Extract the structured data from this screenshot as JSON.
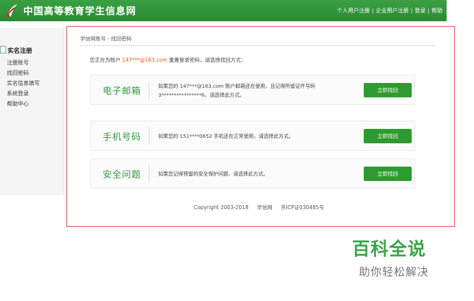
{
  "header": {
    "site_title": "中国高等教育学生信息网",
    "links": [
      "个人用户注册",
      "企业用户注册",
      "登录",
      "帮助"
    ],
    "separator": "|"
  },
  "sidebar": {
    "heading": "实名注册",
    "items": [
      "注册账号",
      "找回密码",
      "实名信息填写",
      "系统登录",
      "帮助中心"
    ]
  },
  "main": {
    "breadcrumb": "学信网账号 - 找回密码",
    "notice_prefix": "您正在为账户",
    "account": "147***@163.com",
    "notice_suffix": "重置登录密码，请选择找回方式：",
    "options": [
      {
        "title": "电子邮箱",
        "desc_line1": "如果您的 147***@163.com 账户邮箱还在使用，且记得所留证件号码",
        "desc_line2": "3****************6，请选择此方式。",
        "button": "立即找回"
      },
      {
        "title": "手机号码",
        "desc_line1": "如果您的 151****0652 手机还在正常使用，请选择此方式。",
        "desc_line2": "",
        "button": "立即找回"
      },
      {
        "title": "安全问题",
        "desc_line1": "如果您记得预留的安全保护问题，请选择此方式。",
        "desc_line2": "",
        "button": "立即找回"
      }
    ]
  },
  "footer": {
    "copyright": "Copyright 2003-2018",
    "site": "学信网",
    "icp": "京ICP证030485号"
  },
  "watermark": {
    "title": "百科全说",
    "subtitle": "助你轻松解决"
  },
  "colors": {
    "brand_green": "#2f9a3a",
    "accent_orange": "#e8561f",
    "highlight_red": "#e24b4b"
  }
}
